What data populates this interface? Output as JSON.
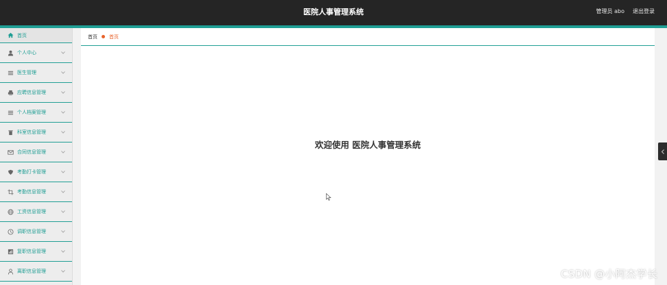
{
  "header": {
    "title": "医院人事管理系统",
    "user_label": "管理员 abo",
    "logout_label": "退出登录",
    "bg_color": "#252525",
    "accent_color": "#1f9e94"
  },
  "sidebar": {
    "items": [
      {
        "label": "首页",
        "icon": "home-icon",
        "has_chevron": false
      },
      {
        "label": "个人中心",
        "icon": "user-icon",
        "has_chevron": true
      },
      {
        "label": "医生管理",
        "icon": "list-icon",
        "has_chevron": true
      },
      {
        "label": "应聘信息管理",
        "icon": "printer-icon",
        "has_chevron": true
      },
      {
        "label": "个人档案管理",
        "icon": "list-icon",
        "has_chevron": true
      },
      {
        "label": "科室信息管理",
        "icon": "trash-icon",
        "has_chevron": true
      },
      {
        "label": "合同信息管理",
        "icon": "mail-icon",
        "has_chevron": true
      },
      {
        "label": "考勤打卡管理",
        "icon": "shield-icon",
        "has_chevron": true
      },
      {
        "label": "考勤信息管理",
        "icon": "crop-icon",
        "has_chevron": true
      },
      {
        "label": "工资信息管理",
        "icon": "globe-icon",
        "has_chevron": true
      },
      {
        "label": "调职信息管理",
        "icon": "clock-icon",
        "has_chevron": true
      },
      {
        "label": "复职信息管理",
        "icon": "chart-icon",
        "has_chevron": true
      },
      {
        "label": "离职信息管理",
        "icon": "person-icon",
        "has_chevron": true
      }
    ]
  },
  "breadcrumb": {
    "home": "首页",
    "current": "首页"
  },
  "main": {
    "welcome": "欢迎使用 医院人事管理系统"
  },
  "watermark": "CSDN @小阿杰学长"
}
